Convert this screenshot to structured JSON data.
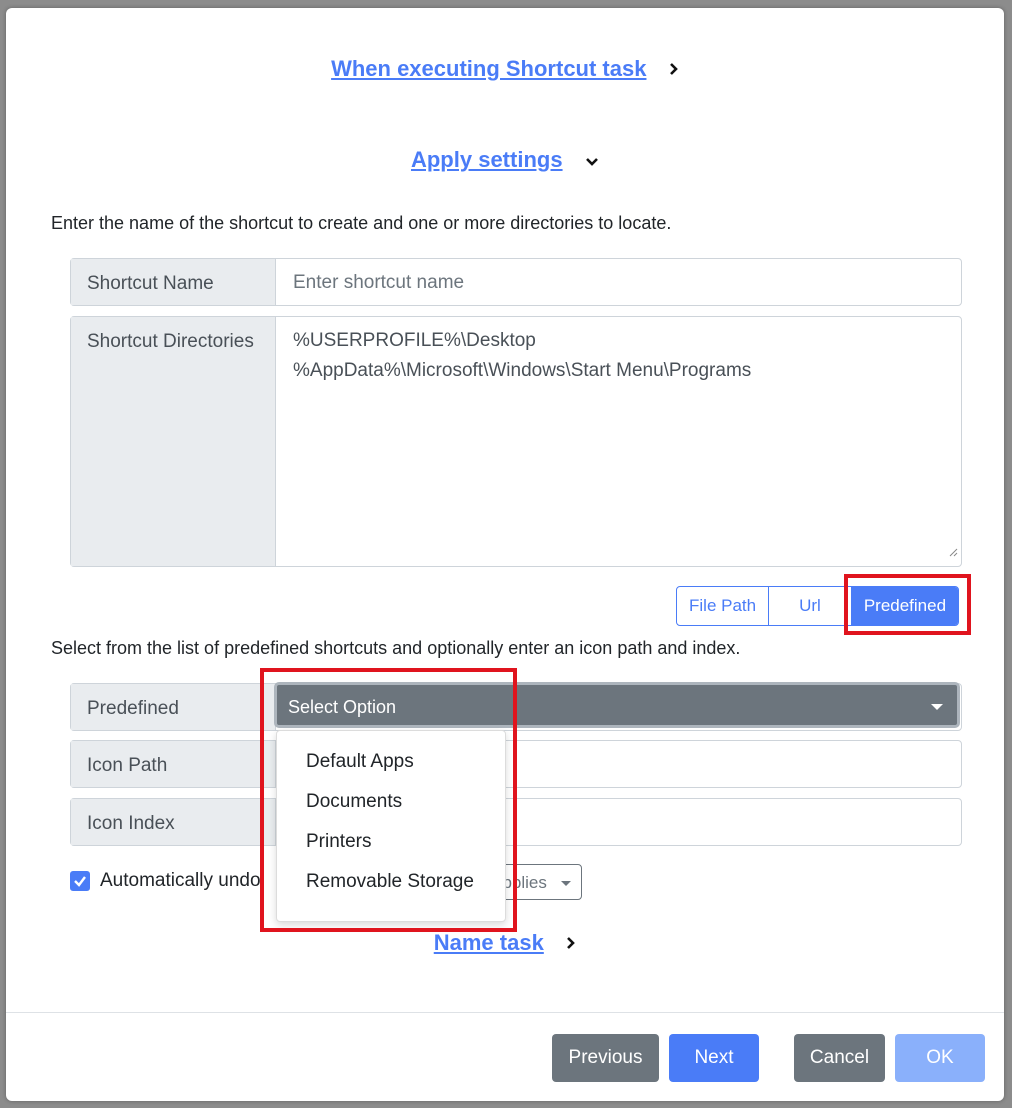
{
  "sections": {
    "executing_title": "When executing Shortcut task",
    "apply_title": "Apply settings",
    "name_task_title": "Name task"
  },
  "shortcut": {
    "description": "Enter the name of the shortcut to create and one or more directories to locate.",
    "name_label": "Shortcut Name",
    "name_placeholder": "Enter shortcut name",
    "dirs_label": "Shortcut Directories",
    "dirs_lines": [
      "%USERPROFILE%\\Desktop",
      "%AppData%\\Microsoft\\Windows\\Start Menu\\Programs"
    ]
  },
  "mode_buttons": {
    "file_path": "File Path",
    "url": "Url",
    "predefined": "Predefined",
    "active": "Predefined"
  },
  "predefined": {
    "description": "Select from the list of predefined shortcuts and optionally enter an icon path and index.",
    "label": "Predefined",
    "select_value": "Select Option",
    "options": [
      "Default Apps",
      "Documents",
      "Printers",
      "Removable Storage"
    ],
    "icon_path_label": "Icon Path",
    "icon_index_label": "Icon Index"
  },
  "undo": {
    "checked": true,
    "label_visible": "Automatically undo",
    "applies_visible": "applies"
  },
  "footer": {
    "previous": "Previous",
    "next": "Next",
    "cancel": "Cancel",
    "ok": "OK"
  },
  "colors": {
    "accent": "#4a7cf7",
    "highlight": "#e0141e",
    "secondary": "#6c757d"
  }
}
